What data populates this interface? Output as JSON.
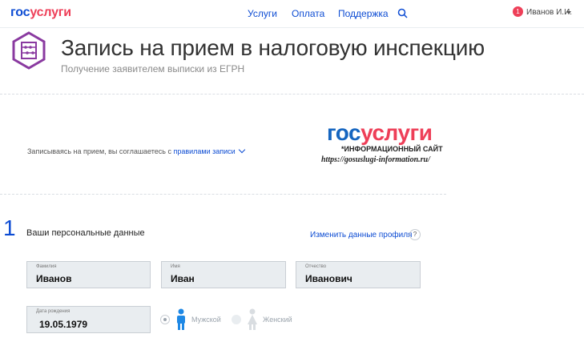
{
  "header": {
    "logo_part1": "гос",
    "logo_part2": "услуги",
    "nav": [
      "Услуги",
      "Оплата",
      "Поддержка"
    ],
    "notification_count": "1",
    "user_name": "Иванов И.И."
  },
  "hero": {
    "title": "Запись на прием в налоговую инспекцию",
    "subtitle": "Получение заявителем выписки из ЕГРН",
    "icon": "abacus-icon"
  },
  "agreement": {
    "text": "Записываясь на прием, вы соглашаетесь с ",
    "link": "правилами записи"
  },
  "watermark": {
    "logo_part1": "гос",
    "logo_part2": "услуги",
    "subtitle": "*ИНФОРМАЦИОННЫЙ САЙТ",
    "url": "https://gosuslugi-information.ru/"
  },
  "step": {
    "number": "1",
    "title": "Ваши персональные данные",
    "edit_link": "Изменить данные профиля",
    "help": "?"
  },
  "fields": {
    "last_name": {
      "label": "Фамилия",
      "value": "Иванов"
    },
    "first_name": {
      "label": "Имя",
      "value": "Иван"
    },
    "patronymic": {
      "label": "Отчество",
      "value": "Иванович"
    },
    "birth_date": {
      "label": "Дата рождения",
      "value": "19.05.1979"
    }
  },
  "gender": {
    "male": "Мужской",
    "female": "Женский",
    "selected": "male"
  },
  "colors": {
    "brand_blue": "#0d4cd3",
    "brand_red": "#ee3f58",
    "field_bg": "#e9edf0",
    "icon_purple": "#8a3aa0"
  }
}
